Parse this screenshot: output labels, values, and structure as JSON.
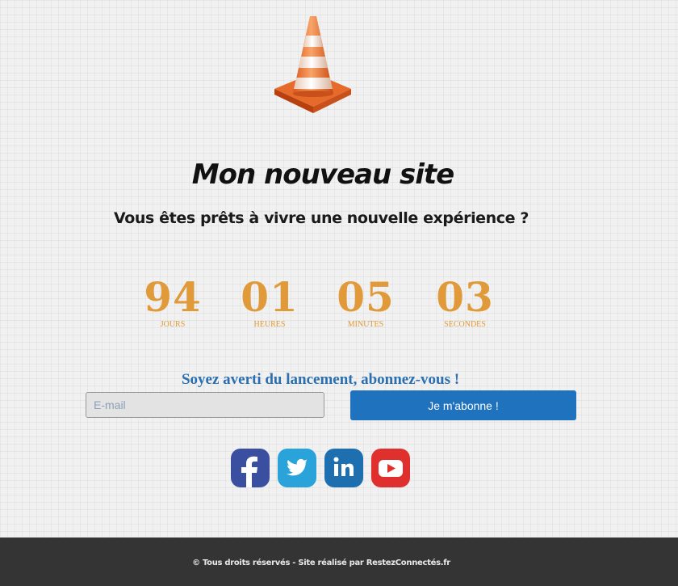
{
  "header": {
    "logo_icon": "traffic-cone-icon",
    "title": "Mon nouveau site",
    "subtitle": "Vous êtes prêts à vivre une nouvelle expérience ?"
  },
  "countdown": {
    "color": "#e09a3a",
    "days": {
      "value": "94",
      "label": "JOURS"
    },
    "hours": {
      "value": "01",
      "label": "HEURES"
    },
    "minutes": {
      "value": "05",
      "label": "MINUTES"
    },
    "seconds": {
      "value": "03",
      "label": "SECONDES"
    }
  },
  "newsletter": {
    "heading": "Soyez averti du lancement, abonnez-vous !",
    "email_placeholder": "E-mail",
    "button_label": "Je m'abonne !",
    "button_color": "#1f72bd"
  },
  "social": [
    {
      "icon": "facebook-icon",
      "color": "#3b4fa0"
    },
    {
      "icon": "twitter-icon",
      "color": "#2aa3db"
    },
    {
      "icon": "linkedin-icon",
      "color": "#1d6fb0"
    },
    {
      "icon": "youtube-icon",
      "color": "#e0302d"
    }
  ],
  "footer": {
    "text": "© Tous droits réservés - Site réalisé par RestezConnectés.fr",
    "background": "#343434"
  }
}
